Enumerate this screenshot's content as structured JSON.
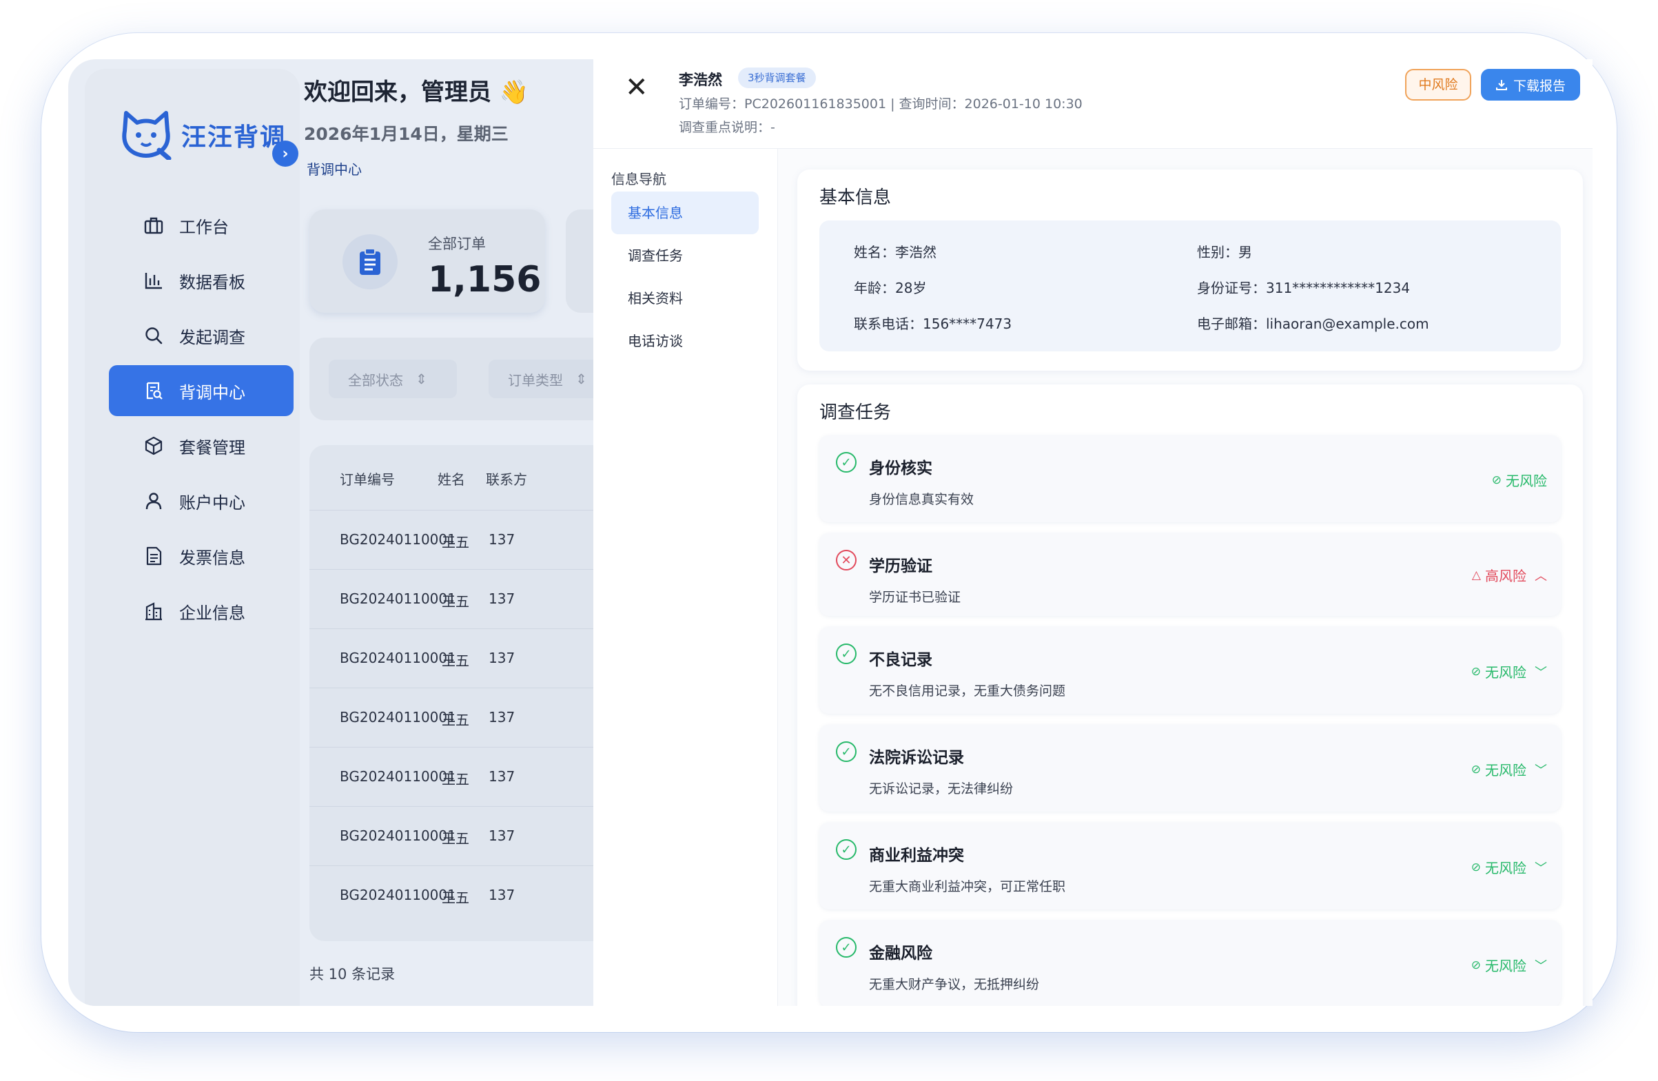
{
  "app": {
    "brand": "汪汪背调",
    "welcome": "欢迎回来，管理员 👋",
    "date": "2026年1月14日，星期三",
    "breadcrumb": "背调中心"
  },
  "sidebar": {
    "items": [
      {
        "label": "工作台",
        "icon": "briefcase-icon"
      },
      {
        "label": "数据看板",
        "icon": "bar-chart-icon"
      },
      {
        "label": "发起调查",
        "icon": "search-icon"
      },
      {
        "label": "背调中心",
        "icon": "document-search-icon",
        "active": true
      },
      {
        "label": "套餐管理",
        "icon": "package-icon"
      },
      {
        "label": "账户中心",
        "icon": "user-icon"
      },
      {
        "label": "发票信息",
        "icon": "invoice-icon"
      },
      {
        "label": "企业信息",
        "icon": "building-icon"
      }
    ]
  },
  "stats": {
    "all_orders_label": "全部订单",
    "all_orders_value": "1,156"
  },
  "filters": {
    "status": "全部状态",
    "type": "订单类型"
  },
  "table": {
    "headers": [
      "订单编号",
      "姓名",
      "联系方"
    ],
    "rows": [
      {
        "id": "BG20240110001",
        "name": "王五",
        "phone": "137"
      },
      {
        "id": "BG20240110001",
        "name": "王五",
        "phone": "137"
      },
      {
        "id": "BG20240110001",
        "name": "王五",
        "phone": "137"
      },
      {
        "id": "BG20240110001",
        "name": "王五",
        "phone": "137"
      },
      {
        "id": "BG20240110001",
        "name": "王五",
        "phone": "137"
      },
      {
        "id": "BG20240110001",
        "name": "王五",
        "phone": "137"
      },
      {
        "id": "BG20240110001",
        "name": "王五",
        "phone": "137"
      }
    ],
    "total": "共 10 条记录"
  },
  "drawer": {
    "name": "李浩然",
    "package": "3秒背调套餐",
    "meta_line": "订单编号：PC202601161835001 | 查询时间：2026-01-10 10:30",
    "focus_line": "调查重点说明：-",
    "risk_level": "中风险",
    "download_label": "下载报告",
    "nav_title": "信息导航",
    "nav_items": [
      "基本信息",
      "调查任务",
      "相关资料",
      "电话访谈"
    ],
    "basic_title": "基本信息",
    "basic": {
      "name": "姓名：李浩然",
      "gender": "性别：男",
      "age": "年龄：28岁",
      "id_card": "身份证号：311************1234",
      "phone": "联系电话：156****7473",
      "email": "电子邮箱：lihaoran@example.com"
    },
    "tasks_title": "调查任务",
    "tasks": [
      {
        "title": "身份核实",
        "desc": "身份信息真实有效",
        "status": "无风险",
        "level": "ok",
        "chevron": ""
      },
      {
        "title": "学历验证",
        "desc": "学历证书已验证",
        "status": "高风险",
        "level": "bad",
        "chevron": "up"
      },
      {
        "title": "不良记录",
        "desc": "无不良信用记录，无重大债务问题",
        "status": "无风险",
        "level": "ok",
        "chevron": "down"
      },
      {
        "title": "法院诉讼记录",
        "desc": "无诉讼记录，无法律纠纷",
        "status": "无风险",
        "level": "ok",
        "chevron": "down"
      },
      {
        "title": "商业利益冲突",
        "desc": "无重大商业利益冲突，可正常任职",
        "status": "无风险",
        "level": "ok",
        "chevron": "down"
      },
      {
        "title": "金融风险",
        "desc": "无重大财产争议，无抵押纠纷",
        "status": "无风险",
        "level": "ok",
        "chevron": "down"
      }
    ]
  },
  "colors": {
    "primary": "#3673e6",
    "ok": "#27b96a",
    "bad": "#e24a5c",
    "warn": "#e07a1e"
  }
}
